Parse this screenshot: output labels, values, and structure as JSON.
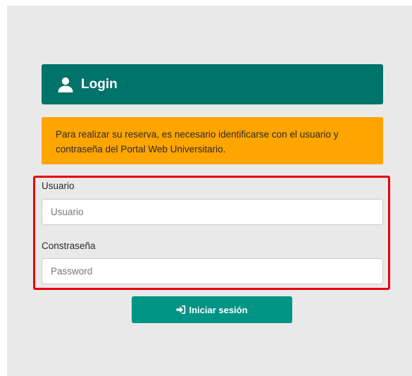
{
  "header": {
    "icon": "user-icon",
    "title": "Login"
  },
  "notice": {
    "text": "Para realizar su reserva, es necesario identificarse con el usuario y contraseña del Portal Web Universitario."
  },
  "form": {
    "username": {
      "label": "Usuario",
      "placeholder": "Usuario",
      "value": ""
    },
    "password": {
      "label": "Constraseña",
      "placeholder": "Password",
      "value": ""
    }
  },
  "submit": {
    "icon": "sign-in-icon",
    "label": "Iniciar sesión"
  },
  "colors": {
    "header_bg": "#00736a",
    "notice_bg": "#ffa500",
    "button_bg": "#009485",
    "highlight_border": "#e8000b",
    "panel_bg": "#e9e9e9"
  }
}
